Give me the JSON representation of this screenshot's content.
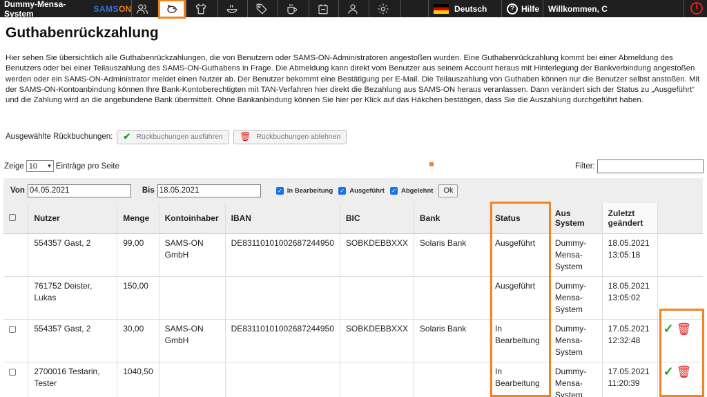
{
  "app": {
    "name": "Dummy-Mensa-System",
    "brand_part1": "SAMS",
    "brand_part2": "ON"
  },
  "topbar": {
    "icons": [
      "users-icon",
      "piggy-bank-icon",
      "shirt-icon",
      "food-bowl-icon",
      "tag-icon",
      "cup-icon",
      "calendar-icon",
      "person-icon",
      "gear-icon"
    ],
    "language": "Deutsch",
    "help": "Hilfe",
    "welcome": "Willkommen, C"
  },
  "page": {
    "title": "Guthabenrückzahlung",
    "intro": "Hier sehen Sie übersichtlich alle Guthabenrückzahlungen, die von Benutzern oder SAMS-ON-Administratoren angestoßen wurden. Eine Guthabenrückzahlung kommt bei einer Abmeldung des Benutzers oder bei einer Teilauszahlung des SAMS-ON-Guthabens in Frage. Die Abmeldung kann direkt vom Benutzer aus seinem Account heraus mit Hinterlegung der Bankverbindung angestoßen werden oder ein SAMS-ON-Administrator meldet einen Nutzer ab. Der Benutzer bekommt eine Bestätigung per E-Mail. Die Teilauszahlung von Guthaben können nur die Benutzer selbst anstoßen. Mit der SAMS-ON-Kontoanbindung können Ihre Bank-Kontoberechtigten mit TAN-Verfahren hier direkt die Bezahlung aus SAMS-ON heraus veranlassen. Dann verändert sich der Status zu „Ausgeführt“ und die Zahlung wird an die angebundene Bank übermittelt. Ohne Bankanbindung können Sie hier per Klick auf das Häkchen bestätigen, dass Sie die Auszahlung durchgeführt haben."
  },
  "bulk": {
    "label": "Ausgewählte Rückbuchungen:",
    "execute": "Rückbuchungen ausführen",
    "reject": "Rückbuchungen ablehnen"
  },
  "length": {
    "prefix": "Zeige",
    "value": "10",
    "suffix": "Einträge pro Seite"
  },
  "filter": {
    "label": "Filter:",
    "value": ""
  },
  "dates": {
    "from_label": "Von",
    "from_value": "04.05.2021",
    "to_label": "Bis",
    "to_value": "18.05.2021",
    "checks": [
      "In Bearbeitung",
      "Ausgeführt",
      "Abgelehnt"
    ],
    "ok": "Ok"
  },
  "table": {
    "headers": [
      "Nutzer",
      "Menge",
      "Kontoinhaber",
      "IBAN",
      "BIC",
      "Bank",
      "Status",
      "Aus System",
      "Zuletzt geändert"
    ],
    "rows": [
      {
        "nutzer": "554357 Gast, 2",
        "menge": "99,00",
        "inhaber": "SAMS-ON GmbH",
        "iban": "DE83110101002687244950",
        "bic": "SOBKDEBBXXX",
        "bank": "Solaris Bank",
        "status": "Ausgeführt",
        "system": "Dummy-Mensa-System",
        "geaendert": "18.05.2021 13:05:18"
      },
      {
        "nutzer": "761752 Deister, Lukas",
        "menge": "150,00",
        "inhaber": "",
        "iban": "",
        "bic": "",
        "bank": "",
        "status": "Ausgeführt",
        "system": "Dummy-Mensa-System",
        "geaendert": "18.05.2021 13:05:02"
      },
      {
        "nutzer": "554357 Gast, 2",
        "menge": "30,00",
        "inhaber": "SAMS-ON GmbH",
        "iban": "DE83110101002687244950",
        "bic": "SOBKDEBBXXX",
        "bank": "Solaris Bank",
        "status": "In Bearbeitung",
        "system": "Dummy-Mensa-System",
        "geaendert": "17.05.2021 12:32:48"
      },
      {
        "nutzer": "2700016 Testarin, Tester",
        "menge": "1040,50",
        "inhaber": "",
        "iban": "",
        "bic": "",
        "bank": "",
        "status": "In Bearbeitung",
        "system": "Dummy-Mensa-System",
        "geaendert": "17.05.2021 11:20:39"
      }
    ]
  },
  "colors": {
    "accent": "#f58220",
    "topbar": "#1f1f1f",
    "confirm": "#1aa61a",
    "delete": "#e02020"
  }
}
